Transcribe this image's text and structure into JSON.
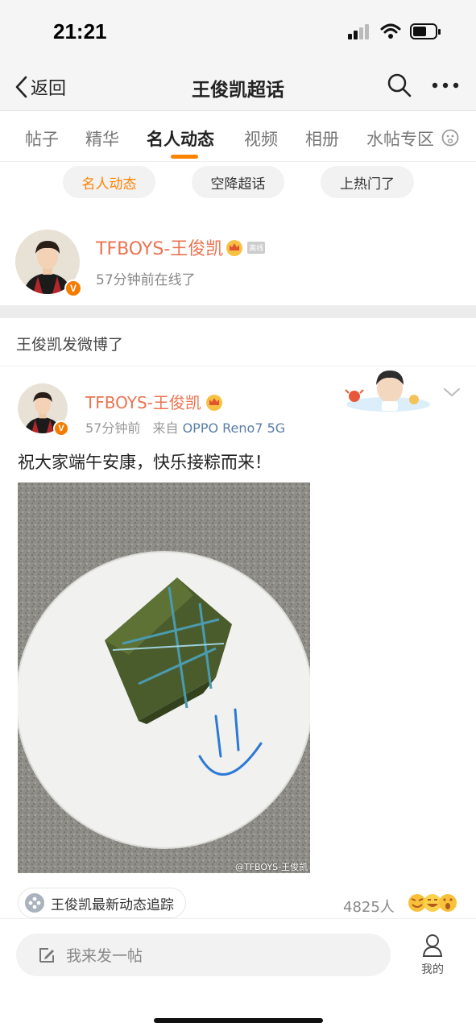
{
  "status_bar": {
    "time": "21:21"
  },
  "nav": {
    "back_label": "返回",
    "title": "王俊凯超话"
  },
  "tabs": {
    "items": [
      "帖子",
      "精华",
      "名人动态",
      "视频",
      "相册",
      "水帖专区"
    ],
    "active": "名人动态"
  },
  "chips": [
    "名人动态",
    "空降超话",
    "上热门了"
  ],
  "celebrity": {
    "name": "TFBOYS-王俊凯",
    "online_tag": "离线",
    "status": "57分钟前在线了",
    "verified_badge": "V"
  },
  "section": {
    "title": "王俊凯发微博了"
  },
  "post": {
    "author": "TFBOYS-王俊凯",
    "time": "57分钟前",
    "source_prefix": "来自",
    "source": "OPPO Reno7 5G",
    "text": "祝大家端午安康，快乐接粽而来！",
    "image_watermark": "@TFBOYS-王俊凯",
    "tracker_label": "王俊凯最新动态追踪",
    "reaction_count": "4825人"
  },
  "bottom": {
    "compose_placeholder": "我来发一帖",
    "profile_label": "我的"
  },
  "colors": {
    "accent": "#ff8200",
    "name_orange": "#eb7350",
    "link_blue": "#5a7ea8"
  },
  "icons": [
    "back-icon",
    "search-icon",
    "more-icon",
    "crown-icon",
    "edit-icon",
    "profile-icon",
    "chevron-down-icon"
  ]
}
